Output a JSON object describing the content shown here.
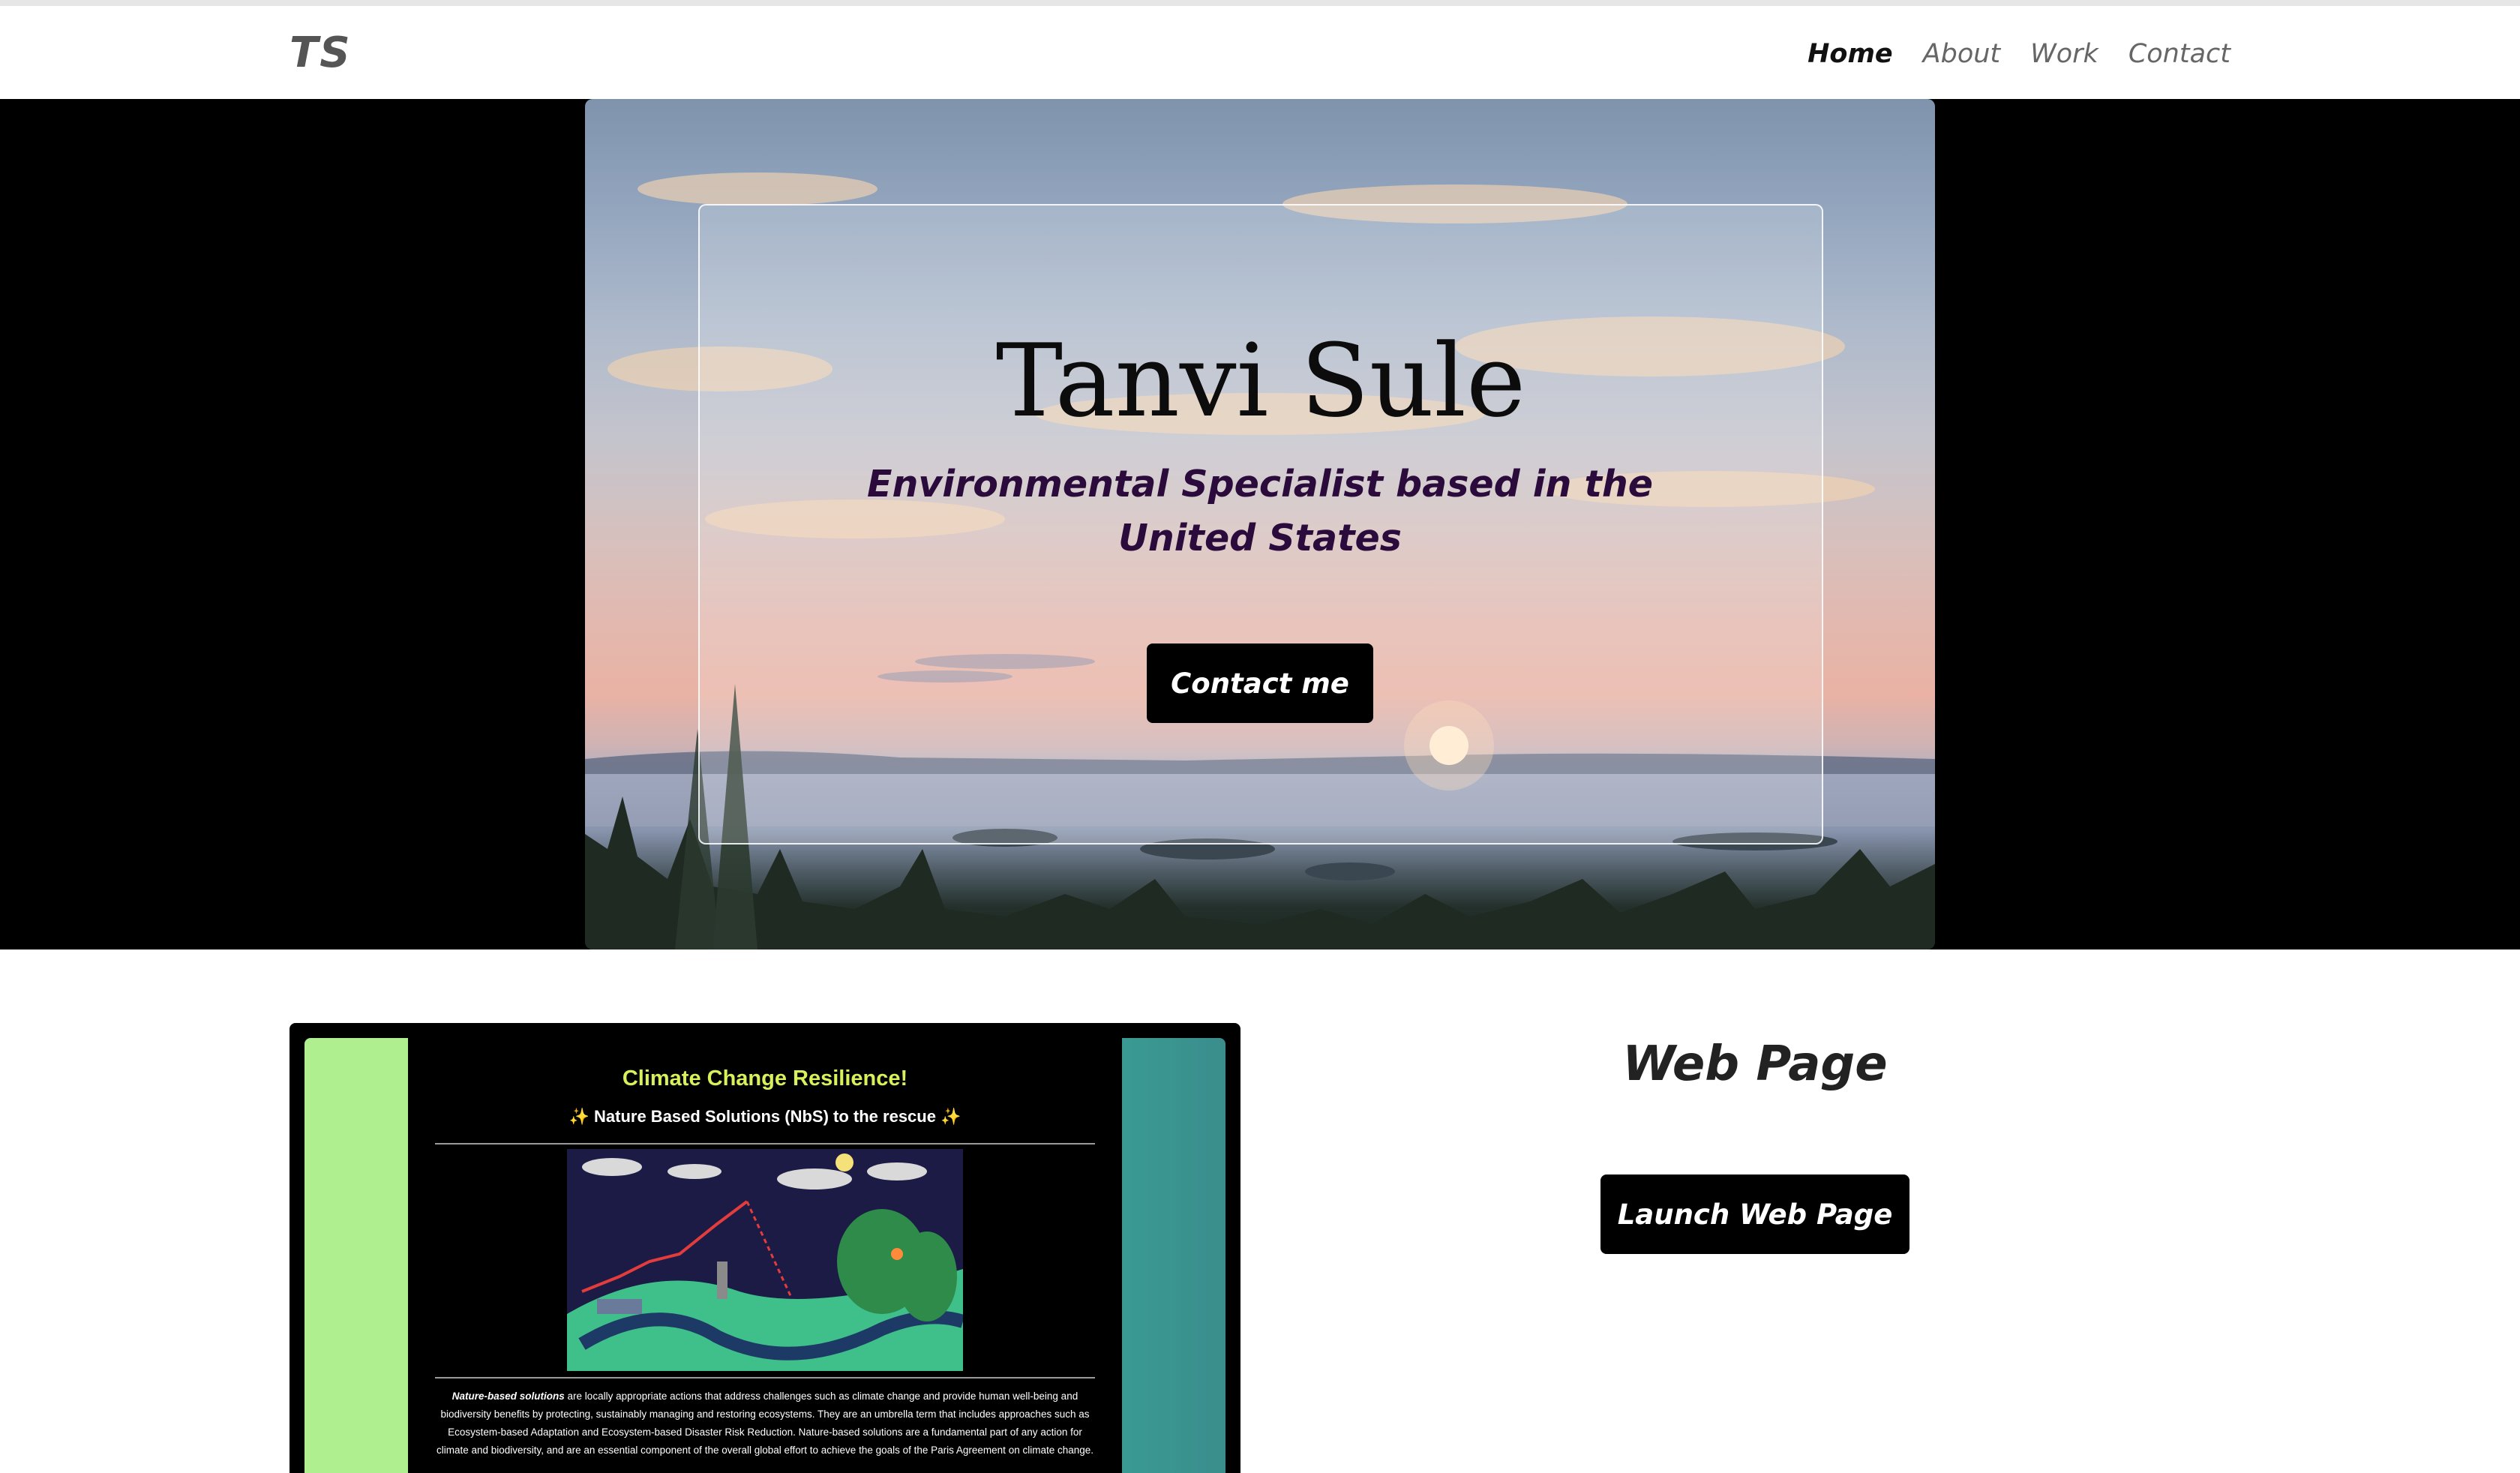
{
  "nav": {
    "logo": "TS",
    "links": [
      {
        "label": "Home",
        "active": true
      },
      {
        "label": "About",
        "active": false
      },
      {
        "label": "Work",
        "active": false
      },
      {
        "label": "Contact",
        "active": false
      }
    ]
  },
  "hero": {
    "title": "Tanvi Sule",
    "subtitle": "Environmental Specialist based in the United States",
    "button_label": "Contact me"
  },
  "project": {
    "preview": {
      "title": "Climate Change Resilience!",
      "subtitle": "✨ Nature Based Solutions (NbS) to the rescue ✨",
      "body_emphasis": "Nature-based solutions",
      "body": " are locally appropriate actions that address challenges such as climate change and provide human well-being and biodiversity benefits by protecting, sustainably managing and restoring ecosystems. They are an umbrella term that includes approaches such as Ecosystem-based Adaptation and Ecosystem-based Disaster Risk Reduction. Nature-based solutions are a fundamental part of any action for climate and biodiversity, and are an essential component of the overall global effort to achieve the goals of the Paris Agreement on climate change."
    },
    "title": "Web Page",
    "button_label": "Launch Web Page"
  },
  "colors": {
    "preview_title": "#d8f05a",
    "preview_left_panel": "#b0ef8f",
    "preview_right_panel": "#3a9a93",
    "hero_subtitle": "#2a0b3b"
  }
}
